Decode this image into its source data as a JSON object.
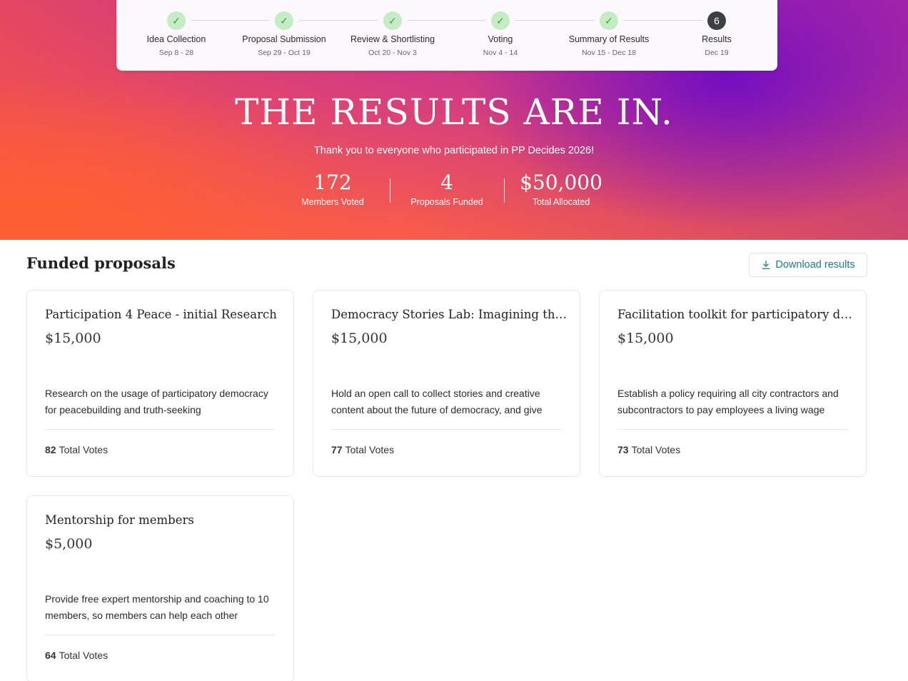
{
  "stepper": {
    "steps": [
      {
        "name": "Idea Collection",
        "date": "Sep 8 - 28",
        "status": "done",
        "icon": "check-icon"
      },
      {
        "name": "Proposal Submission",
        "date": "Sep 29 - Oct 19",
        "status": "done",
        "icon": "check-icon"
      },
      {
        "name": "Review & Shortlisting",
        "date": "Oct 20 - Nov 3",
        "status": "done",
        "icon": "check-icon"
      },
      {
        "name": "Voting",
        "date": "Nov 4 - 14",
        "status": "done",
        "icon": "check-icon"
      },
      {
        "name": "Summary of Results",
        "date": "Nov 15 - Dec 18",
        "status": "done",
        "icon": "check-icon"
      },
      {
        "name": "Results",
        "date": "Dec 19",
        "status": "current",
        "number": "6"
      }
    ]
  },
  "hero": {
    "title": "THE RESULTS ARE IN.",
    "subtitle": "Thank you to everyone who participated in PP Decides 2026!",
    "stats": [
      {
        "value": "172",
        "label": "Members Voted"
      },
      {
        "value": "4",
        "label": "Proposals Funded"
      },
      {
        "value": "$50,000",
        "label": "Total Allocated"
      }
    ]
  },
  "section": {
    "title": "Funded proposals",
    "download_label": "Download results",
    "download_icon": "download-icon"
  },
  "proposals": [
    {
      "title": "Participation 4 Peace - initial Research",
      "amount": "$15,000",
      "description": "Research on the usage of participatory democracy for peacebuilding and truth-seeking",
      "votes": "82",
      "votes_label": "Total Votes"
    },
    {
      "title": "Democracy Stories Lab: Imagining the Future",
      "amount": "$15,000",
      "description": "Hold an open call to collect stories and creative content about the future of democracy, and give",
      "votes": "77",
      "votes_label": "Total Votes"
    },
    {
      "title": "Facilitation toolkit for participatory decision-making",
      "amount": "$15,000",
      "description": "Establish a policy requiring all city contractors and subcontractors to pay employees a living wage",
      "votes": "73",
      "votes_label": "Total Votes"
    },
    {
      "title": "Mentorship for members",
      "amount": "$5,000",
      "description": "Provide free expert mentorship and coaching to 10 members, so members can help each other",
      "votes": "64",
      "votes_label": "Total Votes"
    }
  ],
  "colors": {
    "accent": "#1f7a8c",
    "step_done_bg": "#c6ecc6",
    "step_current_bg": "#3b4045",
    "hero_purple": "#6808c8",
    "hero_orange": "#ff6340"
  }
}
